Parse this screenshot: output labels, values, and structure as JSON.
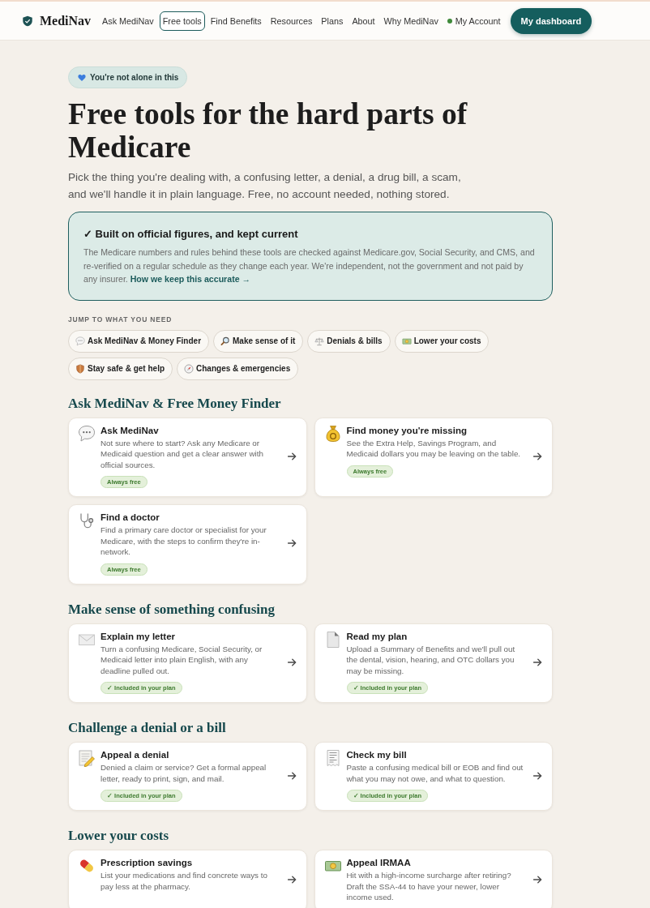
{
  "nav": {
    "brand": "MediNav",
    "links": [
      {
        "label": "Ask MediNav",
        "selected": false,
        "kind": "page"
      },
      {
        "label": "Free tools",
        "selected": true,
        "kind": "page"
      },
      {
        "label": "Find Benefits",
        "selected": false,
        "kind": "page"
      },
      {
        "label": "Resources",
        "selected": false,
        "kind": "page"
      },
      {
        "label": "Plans",
        "selected": false,
        "kind": "page"
      },
      {
        "label": "About",
        "selected": false,
        "kind": "page"
      },
      {
        "label": "Why MediNav",
        "selected": false,
        "kind": "page"
      },
      {
        "label": "My Account",
        "selected": false,
        "kind": "account"
      }
    ],
    "cta": "My dashboard"
  },
  "hero": {
    "badge": "You're not alone in this",
    "title": "Free tools for the hard parts of Medicare",
    "lead": "Pick the thing you're dealing with, a confusing letter, a denial, a drug bill, a scam, and we'll handle it in plain language. Free, no account needed, nothing stored."
  },
  "notice": {
    "title": "✓ Built on official figures, and kept current",
    "body": "The Medicare numbers and rules behind these tools are checked against Medicare.gov, Social Security, and CMS, and re-verified on a regular schedule as they change each year. We're independent, not the government and not paid by any insurer.",
    "link": "How we keep this accurate →"
  },
  "jump": {
    "label": "JUMP TO WHAT YOU NEED",
    "chips": [
      "Ask MediNav & Money Finder",
      "Make sense of it",
      "Denials & bills",
      "Lower your costs",
      "Stay safe & get help",
      "Changes & emergencies"
    ]
  },
  "sections": [
    {
      "title": "Ask MediNav & Free Money Finder",
      "cards": [
        {
          "title": "Ask MediNav",
          "description": "Not sure where to start? Ask any Medicare or Medicaid question and get a clear answer with official sources.",
          "badge": "Always free"
        },
        {
          "title": "Find money you're missing",
          "description": "See the Extra Help, Savings Program, and Medicaid dollars you may be leaving on the table.",
          "badge": "Always free"
        },
        {
          "title": "Find a doctor",
          "description": "Find a primary care doctor or specialist for your Medicare, with the steps to confirm they're in-network.",
          "badge": "Always free"
        }
      ]
    },
    {
      "title": "Make sense of something confusing",
      "cards": [
        {
          "title": "Explain my letter",
          "description": "Turn a confusing Medicare, Social Security, or Medicaid letter into plain English, with any deadline pulled out.",
          "badge": "✓ Included in your plan"
        },
        {
          "title": "Read my plan",
          "description": "Upload a Summary of Benefits and we'll pull out the dental, vision, hearing, and OTC dollars you may be missing.",
          "badge": "✓ Included in your plan"
        }
      ]
    },
    {
      "title": "Challenge a denial or a bill",
      "cards": [
        {
          "title": "Appeal a denial",
          "description": "Denied a claim or service? Get a formal appeal letter, ready to print, sign, and mail.",
          "badge": "✓ Included in your plan"
        },
        {
          "title": "Check my bill",
          "description": "Paste a confusing medical bill or EOB and find out what you may not owe, and what to question.",
          "badge": "✓ Included in your plan"
        }
      ]
    },
    {
      "title": "Lower your costs",
      "cards": [
        {
          "title": "Prescription savings",
          "description": "List your medications and find concrete ways to pay less at the pharmacy."
        },
        {
          "title": "Appeal IRMAA",
          "description": "Hit with a high-income surcharge after retiring? Draft the SSA-44 to have your newer, lower income used."
        }
      ]
    }
  ]
}
